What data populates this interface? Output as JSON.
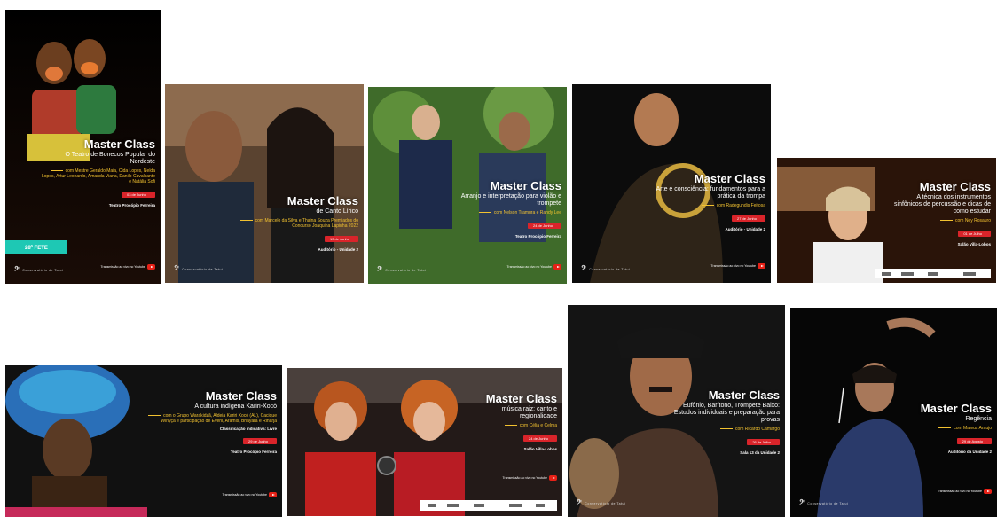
{
  "common": {
    "master_class": "Master Class",
    "youtube": "Transmissão ao vivo no Youtube",
    "logo_text": "Conservatório de Tatuí"
  },
  "cards": [
    {
      "subtitle": "O Teatro de Bonecos Popular do Nordeste",
      "presenters": "com Mestre Geraldo Maia, Cida Lopes, Nelda Lopes, Artur Leonardo, Amanda Viana, Danilo Cavalcante e Natália Sofi",
      "date": "03 de Junho",
      "venue": "Teatro Procópio Ferreira",
      "badge": "28º FETE"
    },
    {
      "subtitle": "de Canto Lírico",
      "presenters": "com Marcelo da Silva e Thaina Souza Premiados do Concurso Joaquina Lapinha 2022",
      "date": "13 de Junho",
      "venue": "Auditório - Unidade 2"
    },
    {
      "subtitle": "Arranjo e interpretação para violão e trompete",
      "presenters": "com Nelson Tramura e Randy Lee",
      "date": "24 de Junho",
      "venue": "Teatro Procópio Ferreira"
    },
    {
      "subtitle": "Arte e consciência: fundamentos para a prática da trompa",
      "presenters": "com Radegundis Feitosa",
      "date": "27 de Junho",
      "venue": "Auditório - Unidade 2"
    },
    {
      "subtitle": "A técnica dos instrumentos sinfônicos de percussão e dicas de como estudar",
      "presenters": "com Ney Rosauro",
      "date": "01 de Julho",
      "venue": "Salão Villa-Lobos"
    },
    {
      "subtitle": "A cultura indígena Kariri-Xocó",
      "presenters": "com o Grupo Warakidzã, Aldeia Kariri Xocó (AL), Cacique Wiriyçá e participação de Eveni, Aramis, Bhayara e Rinarja",
      "classification": "Classificação Indicativa: Livre",
      "date": "29 de Junho",
      "venue": "Teatro Procópio Ferreira"
    },
    {
      "subtitle": "música raiz: canto e regionalidade",
      "presenters": "com Célia e Celma",
      "date": "24 de Junho",
      "venue": "Salão Villa-Lobos"
    },
    {
      "subtitle": "Eufônio, Barítono, Trompete Baixo: Estudos individuais e preparação para provas",
      "presenters": "com Ricardo Camargo",
      "date": "26 de Julho",
      "venue": "Sala 13 da Unidade 2"
    },
    {
      "subtitle": "Regência",
      "presenters": "com Mateus Araujo",
      "date": "29 de Agosto",
      "venue": "Auditório da Unidade 2"
    }
  ],
  "colors": {
    "accent_red": "#d9242a",
    "accent_gold": "#f2c230",
    "fete_teal": "#1ec8b4"
  }
}
